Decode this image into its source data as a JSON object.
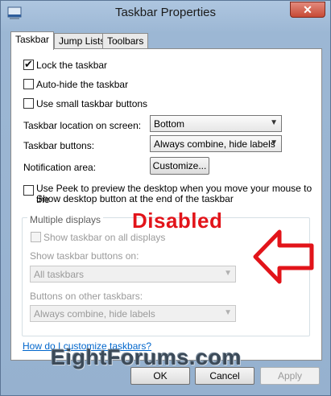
{
  "window": {
    "title": "Taskbar Properties",
    "close_label": "✕"
  },
  "tabs": [
    {
      "label": "Taskbar",
      "active": true
    },
    {
      "label": "Jump Lists",
      "active": false
    },
    {
      "label": "Toolbars",
      "active": false
    }
  ],
  "options": {
    "lock_taskbar": {
      "label": "Lock the taskbar",
      "checked": true
    },
    "auto_hide": {
      "label": "Auto-hide the taskbar",
      "checked": false
    },
    "small_buttons": {
      "label": "Use small taskbar buttons",
      "checked": false
    }
  },
  "settings": {
    "location_label": "Taskbar location on screen:",
    "location_value": "Bottom",
    "buttons_label": "Taskbar buttons:",
    "buttons_value": "Always combine, hide labels",
    "notification_label": "Notification area:",
    "customize_label": "Customize..."
  },
  "peek": {
    "line1": "Use Peek to preview the desktop when you move your mouse to the",
    "line2": "Show desktop button at the end of the taskbar",
    "checked": false
  },
  "multiple_displays": {
    "title": "Multiple displays",
    "show_all_label": "Show taskbar on all displays",
    "show_buttons_label": "Show taskbar buttons on:",
    "show_buttons_value": "All taskbars",
    "other_buttons_label": "Buttons on other taskbars:",
    "other_buttons_value": "Always combine, hide labels"
  },
  "annotation": {
    "text": "Disabled",
    "color": "#e2141a"
  },
  "help_link": "How do I customize taskbars?",
  "watermark": "EightForums.com",
  "footer": {
    "ok": "OK",
    "cancel": "Cancel",
    "apply": "Apply"
  },
  "icons": {
    "app": "taskbar-app-icon",
    "close": "close-icon",
    "dropdown": "chevron-down-icon",
    "arrow": "left-arrow-annotation"
  }
}
